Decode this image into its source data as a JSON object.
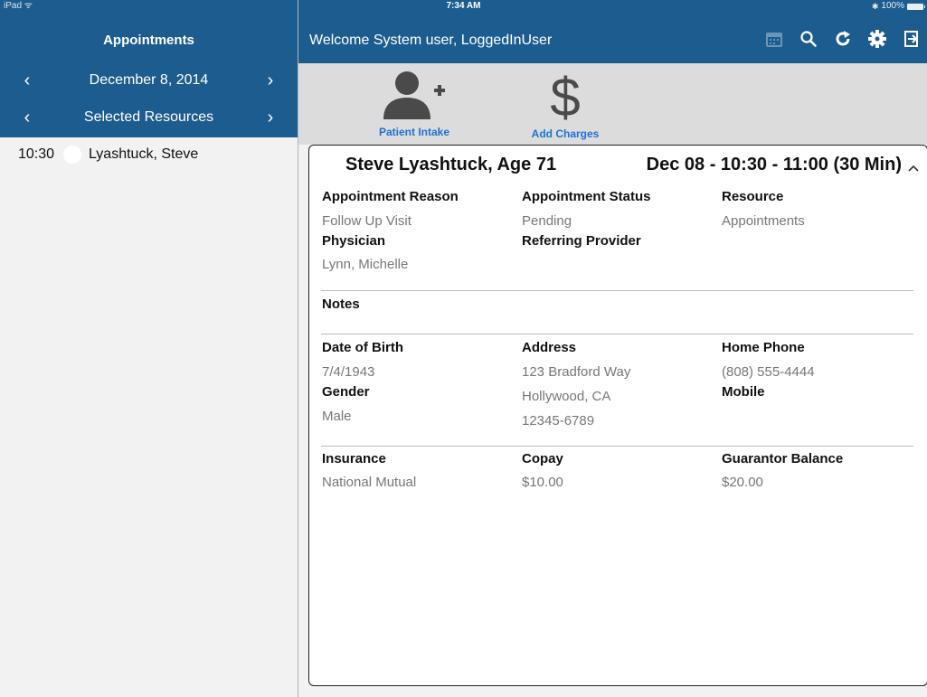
{
  "status_bar": {
    "carrier": "iPad ᯤ",
    "time": "7:34 AM",
    "battery": "100%"
  },
  "sidebar": {
    "title": "Appointments",
    "date_label": "December 8, 2014",
    "resources_label": "Selected Resources",
    "appointments": [
      {
        "time": "10:30",
        "name": "Lyashtuck, Steve"
      }
    ]
  },
  "topbar": {
    "welcome": "Welcome System user, LoggedInUser"
  },
  "actions": {
    "intake_label": "Patient Intake",
    "charges_label": "Add Charges"
  },
  "card": {
    "patient": "Steve Lyashtuck, Age 71",
    "when": "Dec 08 - 10:30 - 11:00 (30 Min)",
    "appointment_reason_label": "Appointment Reason",
    "appointment_reason": "Follow Up Visit",
    "appointment_status_label": "Appointment Status",
    "appointment_status": "Pending",
    "resource_label": "Resource",
    "resource": "Appointments",
    "physician_label": "Physician",
    "physician": "Lynn, Michelle",
    "referring_label": "Referring Provider",
    "notes_label": "Notes",
    "dob_label": "Date of Birth",
    "dob": "7/4/1943",
    "address_label": "Address",
    "address_line1": "123 Bradford Way",
    "address_line2": "Hollywood, CA",
    "address_line3": "12345-6789",
    "home_phone_label": "Home Phone",
    "home_phone": "(808) 555-4444",
    "gender_label": "Gender",
    "gender": "Male",
    "mobile_label": "Mobile",
    "insurance_label": "Insurance",
    "insurance": "National Mutual",
    "copay_label": "Copay",
    "copay": "$10.00",
    "guarantor_label": "Guarantor Balance",
    "guarantor": "$20.00"
  },
  "colors": {
    "header": "#1d5c8f",
    "link": "#1b73d1",
    "icon_gray": "#4a4a4a"
  }
}
